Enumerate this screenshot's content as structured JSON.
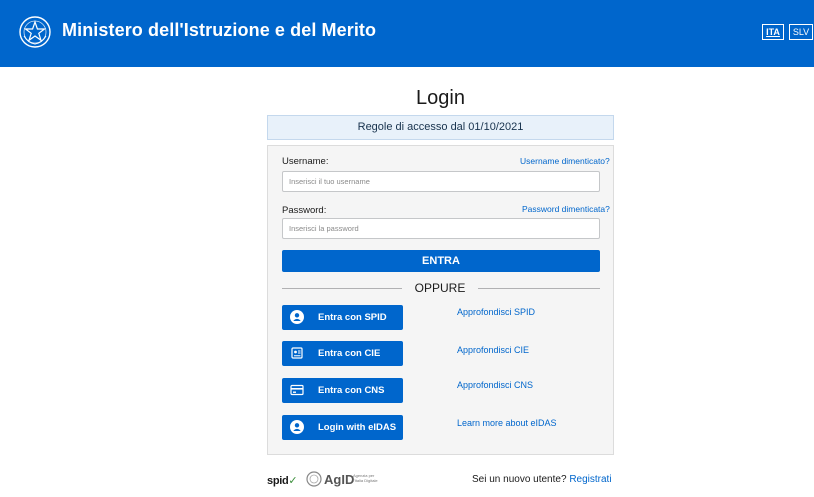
{
  "header": {
    "title": "Ministero dell'Istruzione e del Merito",
    "lang_ita": "ITA",
    "lang_slv": "SLV"
  },
  "page": {
    "title": "Login",
    "rules_link": "Regole di accesso dal 01/10/2021"
  },
  "form": {
    "username_label": "Username:",
    "username_forgot": "Username dimenticato?",
    "username_placeholder": "Inserisci il tuo username",
    "password_label": "Password:",
    "password_forgot": "Password dimenticata?",
    "password_placeholder": "Inserisci la password",
    "submit_label": "ENTRA"
  },
  "oppure": "OPPURE",
  "providers": [
    {
      "button": "Entra con SPID",
      "link": "Approfondisci SPID",
      "icon": "user-circle-icon"
    },
    {
      "button": "Entra con CIE",
      "link": "Approfondisci CIE",
      "icon": "id-card-icon"
    },
    {
      "button": "Entra con CNS",
      "link": "Approfondisci CNS",
      "icon": "smart-card-icon"
    },
    {
      "button": "Login with eIDAS",
      "link": "Learn more about eIDAS",
      "icon": "user-circle-icon"
    }
  ],
  "footer": {
    "spid_logo": "spid",
    "spid_check": "✓",
    "agid_logo": "AgID",
    "agid_sub": "Agenzia per l'Italia Digitale",
    "new_user_text": "Sei un nuovo utente?",
    "register_link": "Registrati"
  },
  "colors": {
    "brand_blue": "#0066cc",
    "card_bg": "#f5f5f5",
    "rules_bg": "#e8f1fa"
  }
}
